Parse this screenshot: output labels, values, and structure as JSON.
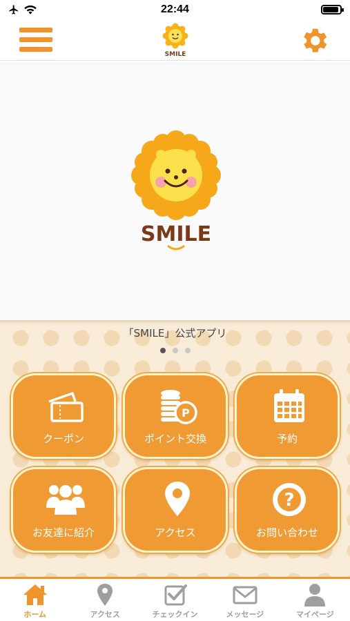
{
  "status_bar": {
    "time": "22:44",
    "battery_level": 0.9
  },
  "nav": {
    "logo_text": "SMILE"
  },
  "hero": {
    "logo_text": "SMILE"
  },
  "subtitle": "「SMILE」公式アプリ",
  "carousel": {
    "pages": 3,
    "active_index": 0
  },
  "tiles": [
    {
      "label": "クーポン",
      "icon": "ticket-icon"
    },
    {
      "label": "ポイント交換",
      "icon": "coins-icon"
    },
    {
      "label": "予約",
      "icon": "calendar-icon"
    },
    {
      "label": "お友達に紹介",
      "icon": "people-icon"
    },
    {
      "label": "アクセス",
      "icon": "location-pin-icon"
    },
    {
      "label": "お問い合わせ",
      "icon": "question-icon"
    }
  ],
  "tabs": [
    {
      "label": "ホーム",
      "icon": "home-icon",
      "active": true
    },
    {
      "label": "アクセス",
      "icon": "location-pin-icon",
      "active": false
    },
    {
      "label": "チェックイン",
      "icon": "checkbox-icon",
      "active": false
    },
    {
      "label": "メッセージ",
      "icon": "mail-icon",
      "active": false
    },
    {
      "label": "マイページ",
      "icon": "user-icon",
      "active": false
    }
  ],
  "colors": {
    "accent": "#f0932b",
    "tile": "#ef9a33",
    "logo_text": "#7a3a1a"
  }
}
